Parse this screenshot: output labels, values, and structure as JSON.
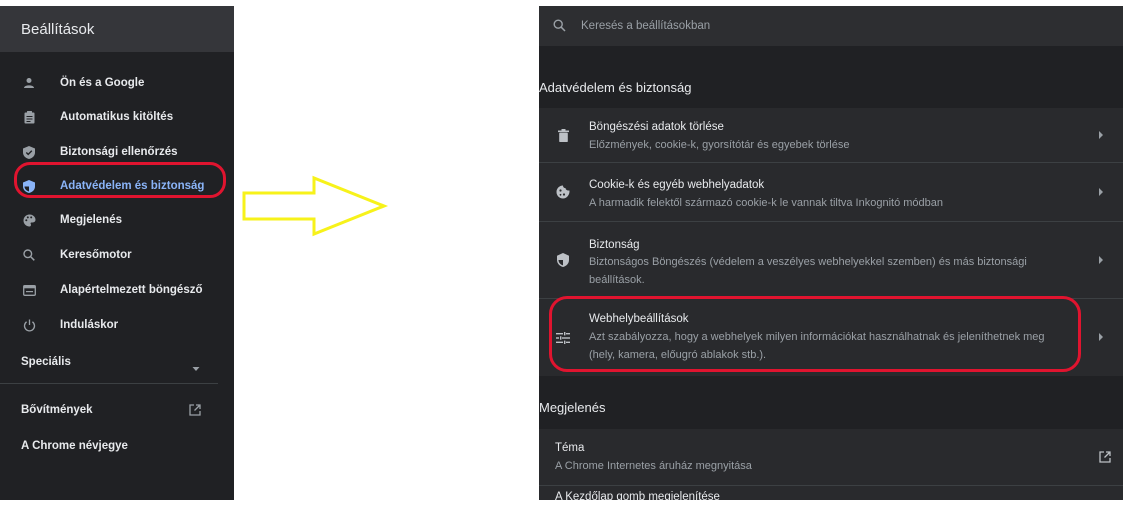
{
  "sidebar": {
    "title": "Beállítások",
    "items": [
      {
        "label": "Ön és a Google",
        "icon": "person-icon"
      },
      {
        "label": "Automatikus kitöltés",
        "icon": "clipboard-icon"
      },
      {
        "label": "Biztonsági ellenőrzés",
        "icon": "shield-check-icon"
      },
      {
        "label": "Adatvédelem és biztonság",
        "icon": "shield-icon",
        "active": true
      },
      {
        "label": "Megjelenés",
        "icon": "palette-icon"
      },
      {
        "label": "Keresőmotor",
        "icon": "search-icon"
      },
      {
        "label": "Alapértelmezett böngésző",
        "icon": "browser-icon"
      },
      {
        "label": "Induláskor",
        "icon": "power-icon"
      }
    ],
    "advanced": "Speciális",
    "extensions": "Bővítmények",
    "about": "A Chrome névjegye"
  },
  "search": {
    "placeholder": "Keresés a beállításokban"
  },
  "privacy": {
    "title": "Adatvédelem és biztonság",
    "rows": [
      {
        "title": "Böngészési adatok törlése",
        "subtitle": "Előzmények, cookie-k, gyorsítótár és egyebek törlése",
        "icon": "trash-icon"
      },
      {
        "title": "Cookie-k és egyéb webhelyadatok",
        "subtitle": "A harmadik felektől származó cookie-k le vannak tiltva Inkognitó módban",
        "icon": "cookie-icon"
      },
      {
        "title": "Biztonság",
        "subtitle": "Biztonságos Böngészés (védelem a veszélyes webhelyekkel szemben) és más biztonsági beállítások.",
        "icon": "shield-icon"
      },
      {
        "title": "Webhelybeállítások",
        "subtitle": "Azt szabályozza, hogy a webhelyek milyen információkat használhatnak és jeleníthetnek meg (hely, kamera, előugró ablakok stb.).",
        "icon": "sliders-icon"
      }
    ]
  },
  "appearance": {
    "title": "Megjelenés",
    "rows": [
      {
        "title": "Téma",
        "subtitle": "A Chrome Internetes áruház megnyitása"
      },
      {
        "title": "A Kezdőlap gomb megjelenítése"
      }
    ]
  },
  "colors": {
    "background": "#202124",
    "header": "#35363a",
    "card": "#292a2d",
    "accent": "#8ab4f8",
    "highlight": "#e0142f",
    "arrow": "#f7f21a"
  }
}
